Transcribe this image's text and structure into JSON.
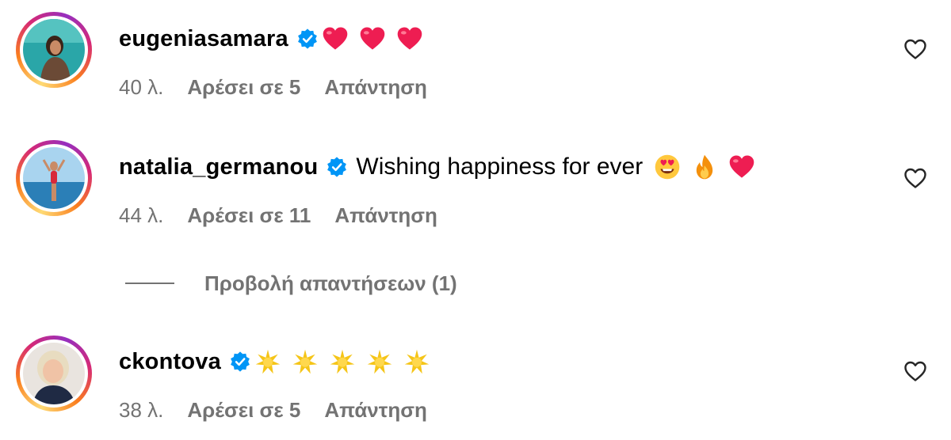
{
  "comments": [
    {
      "username": "eugeniasamara",
      "text": "",
      "emojis": [
        "red-heart",
        "red-heart",
        "red-heart"
      ],
      "time": "40 λ.",
      "likes": "Αρέσει σε 5",
      "reply": "Απάντηση"
    },
    {
      "username": "natalia_germanou",
      "text": "Wishing happiness for ever",
      "emojis": [
        "heart-eyes-face",
        "fire",
        "red-heart"
      ],
      "time": "44 λ.",
      "likes": "Αρέσει σε 11",
      "reply": "Απάντηση"
    },
    {
      "username": "ckontova",
      "text": "",
      "emojis": [
        "glowing-star",
        "glowing-star",
        "glowing-star",
        "glowing-star",
        "glowing-star"
      ],
      "time": "38 λ.",
      "likes": "Αρέσει σε 5",
      "reply": "Απάντηση"
    }
  ],
  "view_replies": {
    "label": "Προβολή απαντήσεων (1)"
  },
  "colors": {
    "verified": "#0095f6",
    "secondary_text": "#737373",
    "heart": "#ee1d52",
    "star": "#f5c518"
  },
  "icons": [
    "verified-badge-icon",
    "heart-outline-icon",
    "red-heart-emoji",
    "heart-eyes-emoji",
    "fire-emoji",
    "glowing-star-emoji"
  ]
}
